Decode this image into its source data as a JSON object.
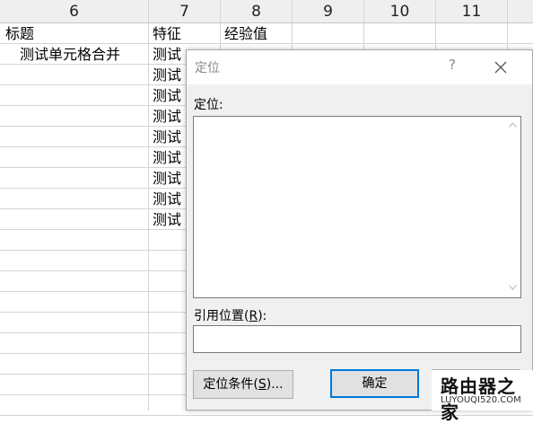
{
  "sheet": {
    "columns": [
      "6",
      "7",
      "8",
      "9",
      "10",
      "11"
    ],
    "row1": {
      "c6": "标题",
      "c7": "特征",
      "c8": "经验值"
    },
    "merged_cell": "测试单元格合并",
    "col7_cells": [
      "测试",
      "测试",
      "测试",
      "测试",
      "测试",
      "测试",
      "测试",
      "测试",
      "测试"
    ]
  },
  "dialog": {
    "title": "定位",
    "help": "?",
    "goto_label": "定位:",
    "reference_label_prefix": "引用位置(",
    "reference_label_key": "R",
    "reference_label_suffix": "):",
    "reference_value": "",
    "special_prefix": "定位条件(",
    "special_key": "S",
    "special_suffix": ")...",
    "ok_label": "确定"
  },
  "watermark": {
    "top": "路由器之家",
    "bottom": "LUYOUQI520.COM"
  },
  "colors": {
    "accent": "#0078d7",
    "grid": "#d4d4d4",
    "header_bg": "#efefef"
  }
}
